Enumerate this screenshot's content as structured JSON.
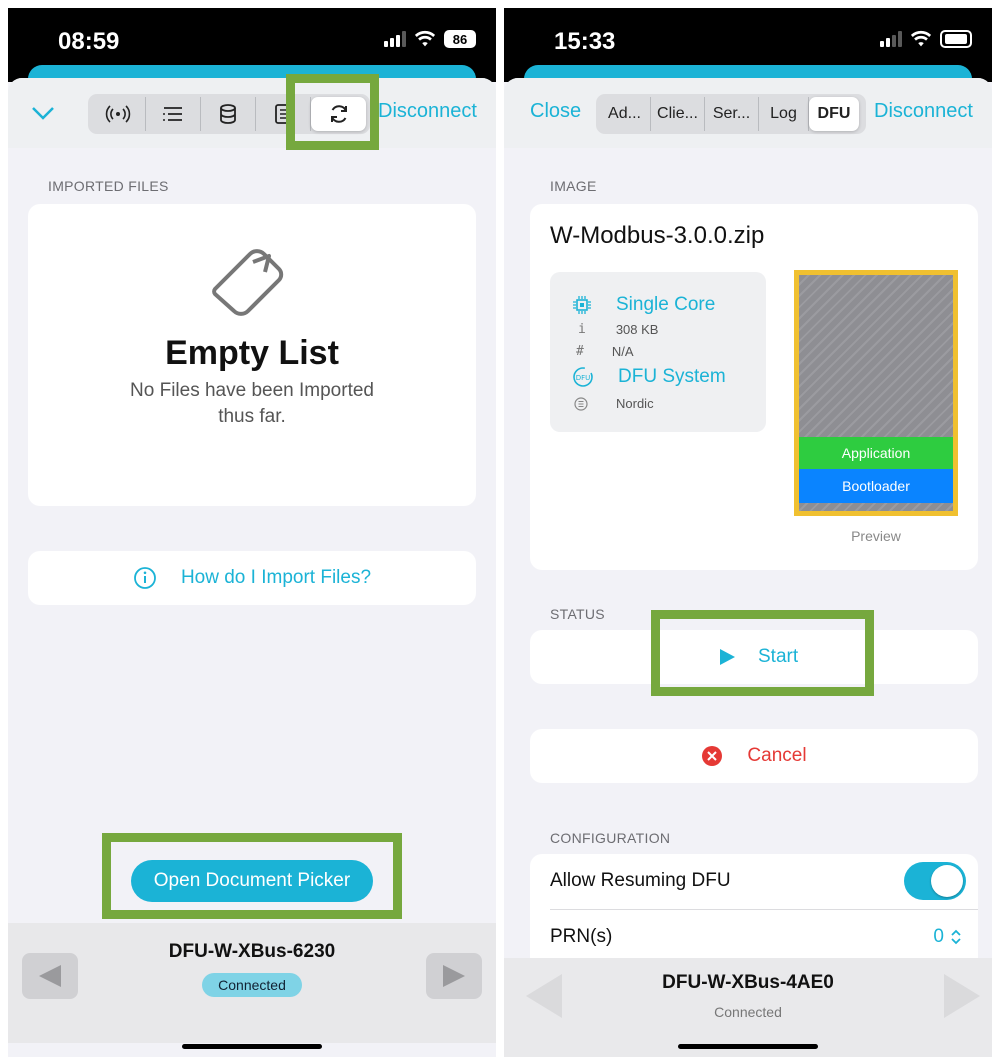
{
  "left": {
    "status_time": "08:59",
    "battery": "86",
    "disconnect_label": "Disconnect",
    "imported_files_label": "IMPORTED FILES",
    "empty_title": "Empty List",
    "empty_subtitle_line1": "No Files have been Imported",
    "empty_subtitle_line2": "thus far.",
    "how_import_label": "How do I Import Files?",
    "open_picker_label": "Open Document Picker",
    "device_name": "DFU-W-XBus-6230",
    "device_status": "Connected"
  },
  "right": {
    "status_time": "15:33",
    "close_label": "Close",
    "disconnect_label": "Disconnect",
    "tabs": [
      "Ad...",
      "Clie...",
      "Ser...",
      "Log",
      "DFU"
    ],
    "selected_tab": "DFU",
    "image_label": "IMAGE",
    "file_name": "W-Modbus-3.0.0.zip",
    "info": {
      "core": "Single Core",
      "size": "308 KB",
      "hash": "N/A",
      "system": "DFU System",
      "vendor": "Nordic"
    },
    "preview_segments": [
      "Application",
      "Bootloader"
    ],
    "preview_label": "Preview",
    "status_label": "STATUS",
    "start_label": "Start",
    "cancel_label": "Cancel",
    "configuration_label": "CONFIGURATION",
    "allow_resuming_label": "Allow Resuming DFU",
    "allow_resuming_on": true,
    "prn_label": "PRN(s)",
    "prn_value": "0",
    "device_name": "DFU-W-XBus-4AE0",
    "device_status": "Connected"
  },
  "colors": {
    "accent": "#1bb3d6",
    "highlight": "#76a83e",
    "cancel_red": "#e53935",
    "application_green": "#2ecc40",
    "bootloader_blue": "#0a84ff",
    "preview_border": "#f0c030"
  }
}
